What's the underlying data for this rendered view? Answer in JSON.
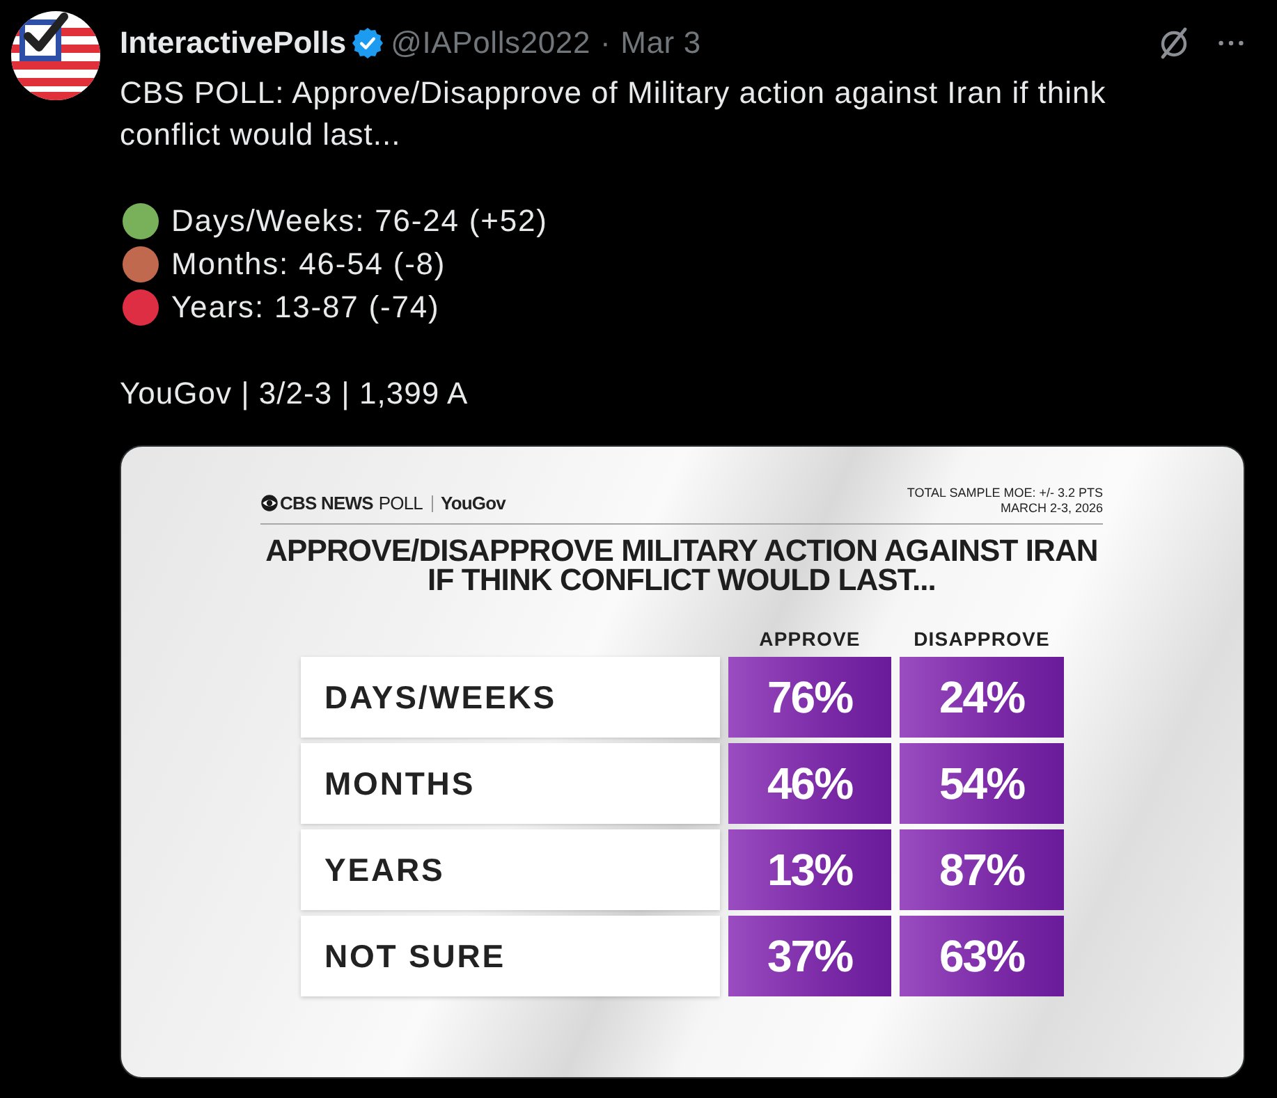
{
  "post": {
    "author": {
      "name": "InteractivePolls",
      "verified": true,
      "handle": "@IAPolls2022",
      "separator": "·",
      "date": "Mar 3"
    },
    "text": "CBS POLL: Approve/Disapprove of Military action against Iran if think conflict would last...",
    "results": [
      {
        "text": "Days/Weeks: 76-24 (+52)",
        "color": "#78b159"
      },
      {
        "text": "Months: 46-54 (-8)",
        "color": "#c1694f"
      },
      {
        "text": "Years: 13-87 (-74)",
        "color": "#dd2e44"
      }
    ],
    "source": "YouGov | 3/2-3 | 1,399 A",
    "graphic": {
      "brand": {
        "network": "CBS NEWS",
        "product": "POLL",
        "partner": "YouGov"
      },
      "moe": "TOTAL SAMPLE MOE: +/- 3.2 PTS",
      "dates": "MARCH 2-3, 2026",
      "title": [
        "APPROVE/DISAPPROVE MILITARY ACTION AGAINST IRAN",
        "IF THINK CONFLICT WOULD LAST..."
      ],
      "columns": [
        "APPROVE",
        "DISAPPROVE"
      ],
      "rows": [
        {
          "label": "DAYS/WEEKS",
          "values": [
            "76%",
            "24%"
          ]
        },
        {
          "label": "MONTHS",
          "values": [
            "46%",
            "54%"
          ]
        },
        {
          "label": "YEARS",
          "values": [
            "13%",
            "87%"
          ]
        },
        {
          "label": "NOT SURE",
          "values": [
            "37%",
            "63%"
          ]
        }
      ]
    }
  }
}
